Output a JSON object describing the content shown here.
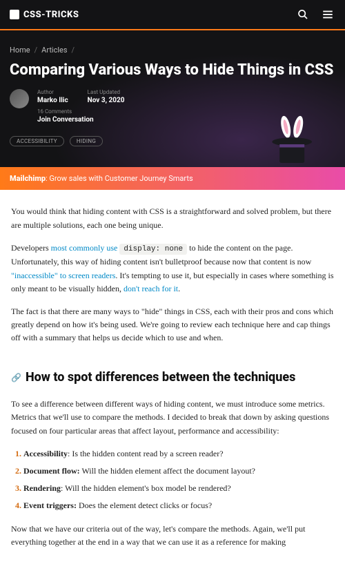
{
  "site": {
    "name": "CSS-TRICKS"
  },
  "breadcrumb": {
    "home": "Home",
    "sep": "/",
    "articles": "Articles",
    "sep2": "/"
  },
  "article": {
    "title": "Comparing Various Ways to Hide Things in CSS",
    "author_label": "Author",
    "author": "Marko Ilic",
    "updated_label": "Last Updated",
    "updated": "Nov 3, 2020",
    "comments": "16 Comments",
    "join": "Join Conversation"
  },
  "tags": [
    "ACCESSIBILITY",
    "HIDING"
  ],
  "sponsor": {
    "brand": "Mailchimp",
    "text": ": Grow sales with Customer Journey Smarts"
  },
  "body": {
    "p1": "You would think that hiding content with CSS is a straightforward and solved problem, but there are multiple solutions, each one being unique.",
    "p2a": "Developers ",
    "p2link1": "most commonly use",
    "p2code": "display: none",
    "p2b": " to hide the content on the page. Unfortunately, this way of hiding content isn't bulletproof because now that content is now ",
    "p2link2": "\"inaccessible\" to screen readers",
    "p2c": ". It's tempting to use it, but especially in cases where something is only meant to be visually hidden, ",
    "p2link3": "don't reach for it",
    "p2d": ".",
    "p3": "The fact is that there are many ways to \"hide\" things in CSS, each with their pros and cons which greatly depend on how it's being used. We're going to review each technique here and cap things off with a summary that helps us decide which to use and when.",
    "h2": "How to spot differences between the techniques",
    "p4": "To see a difference between different ways of hiding content, we must introduce some metrics. Metrics that we'll use to compare the methods. I decided to break that down by asking questions focused on four particular areas that affect layout, performance and accessibility:",
    "list": [
      {
        "b": "Accessibility",
        "t": ": Is the hidden content read by a screen reader?"
      },
      {
        "b": "Document flow:",
        "t": " Will the hidden element affect the document layout?"
      },
      {
        "b": "Rendering",
        "t": ": Will the hidden element's box model be rendered?"
      },
      {
        "b": "Event triggers:",
        "t": " Does the element detect clicks or focus?"
      }
    ],
    "p5": "Now that we have our criteria out of the way, let's compare the methods. Again, we'll put everything together at the end in a way that we can use it as a reference for making"
  }
}
